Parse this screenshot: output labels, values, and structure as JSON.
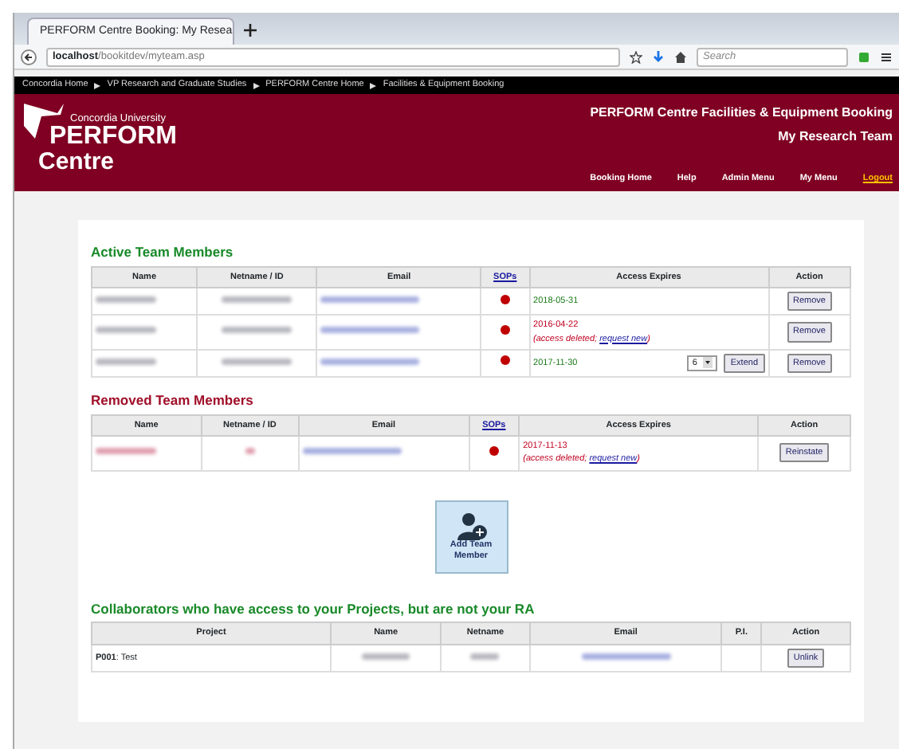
{
  "browser": {
    "tab_title": "PERFORM Centre Booking: My Resea",
    "address_host": "localhost",
    "address_path": "/bookitdev/myteam.asp",
    "search_placeholder": "Search"
  },
  "breadcrumbs": [
    "Concordia Home",
    "VP Research and Graduate Studies",
    "PERFORM Centre Home",
    "Facilities & Equipment Booking"
  ],
  "header": {
    "university": "Concordia University",
    "logo_line_1": "PERFORM",
    "logo_line_2": "Centre",
    "title": "PERFORM Centre Facilities & Equipment Booking",
    "subtitle": "My Research Team",
    "nav": [
      {
        "label": "Booking Home",
        "kind": "link"
      },
      {
        "label": "Help",
        "kind": "link"
      },
      {
        "label": "Admin Menu",
        "kind": "link"
      },
      {
        "label": "My Menu",
        "kind": "link"
      },
      {
        "label": "Logout",
        "kind": "logout"
      }
    ]
  },
  "active": {
    "title": "Active Team Members",
    "columns": [
      "Name",
      "Netname / ID",
      "Email",
      "SOPs",
      "Access Expires",
      "Action"
    ],
    "rows": [
      {
        "expires": "2018-05-31",
        "expired": false,
        "action": "Remove"
      },
      {
        "expires": "2016-04-22",
        "expired": true,
        "note": "(access deleted; ",
        "note_link": "request new",
        "note_end": ")",
        "action": "Remove"
      },
      {
        "expires": "2017-11-30",
        "expired": false,
        "extend_value": "6",
        "extend_button": "Extend",
        "action": "Remove"
      }
    ]
  },
  "removed": {
    "title": "Removed Team Members",
    "columns": [
      "Name",
      "Netname / ID",
      "Email",
      "SOPs",
      "Access Expires",
      "Action"
    ],
    "rows": [
      {
        "expires": "2017-11-13",
        "expired": true,
        "note": "(access deleted; ",
        "note_link": "request new",
        "note_end": ")",
        "action": "Reinstate"
      }
    ]
  },
  "add_button": {
    "label": "Add Team Member"
  },
  "collaborators": {
    "title": "Collaborators who have access to your Projects, but are not your RA",
    "columns": [
      "Project",
      "Name",
      "Netname",
      "Email",
      "P.I.",
      "Action"
    ],
    "rows": [
      {
        "project_code": "P001",
        "project_name": ": Test",
        "action": "Unlink"
      }
    ]
  }
}
